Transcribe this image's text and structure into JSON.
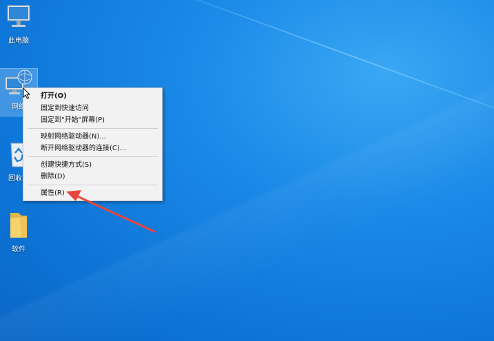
{
  "desktop": {
    "icons": [
      {
        "label": "此电脑",
        "icon": "computer-icon"
      },
      {
        "label": "网络",
        "icon": "network-icon"
      },
      {
        "label": "回收站",
        "icon": "recycle-bin-icon"
      },
      {
        "label": "软件",
        "icon": "folder-icon"
      }
    ]
  },
  "context_menu": {
    "items": [
      {
        "label": "打开(O)"
      },
      {
        "label": "固定到快速访问"
      },
      {
        "label": "固定到\"开始\"屏幕(P)"
      },
      {
        "label": "映射网络驱动器(N)..."
      },
      {
        "label": "断开网络驱动器的连接(C)..."
      },
      {
        "label": "创建快捷方式(S)"
      },
      {
        "label": "删除(D)"
      },
      {
        "label": "属性(R)"
      }
    ]
  },
  "colors": {
    "wallpaper": "#0d74d6",
    "menu_bg": "#f2f2f2",
    "annotation_arrow": "#e8453c"
  }
}
